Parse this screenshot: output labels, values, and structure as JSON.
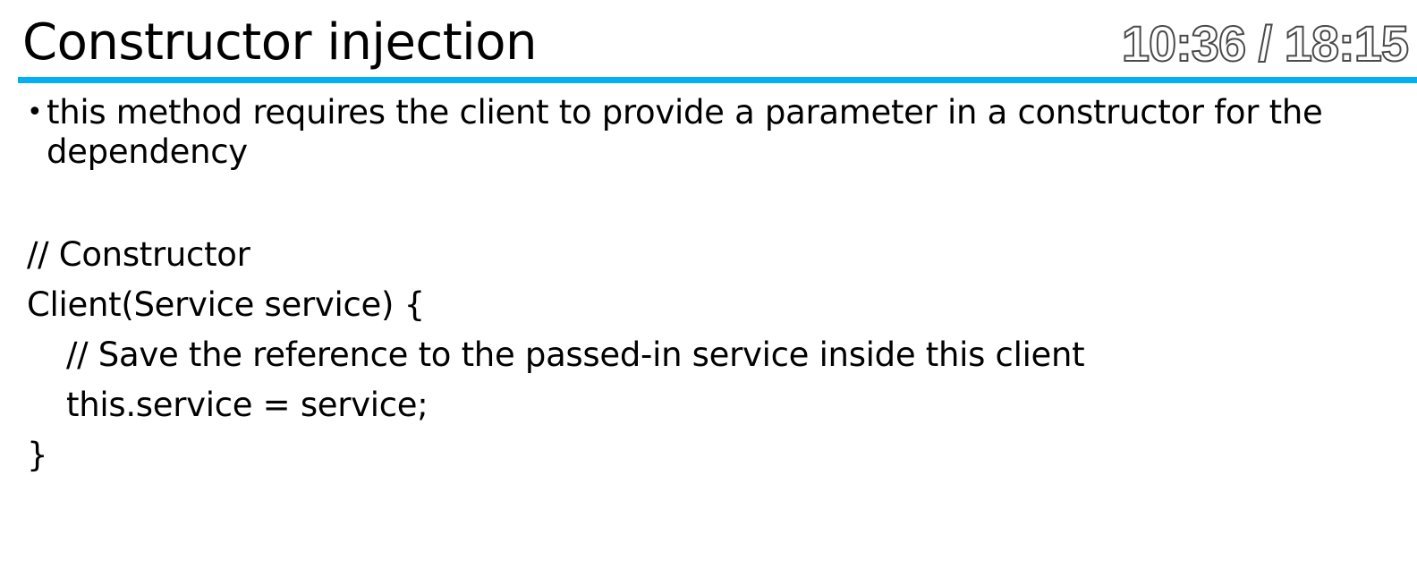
{
  "slide": {
    "title": "Constructor injection",
    "timer": "10:36 / 18:15",
    "accent_color": "#00b0f0",
    "bullet": {
      "mark": "•",
      "text": "this method requires the client to provide a parameter in a constructor for the dependency"
    },
    "code_lines": [
      "// Constructor",
      "Client(Service service) {",
      "// Save the reference to the passed-in service inside this client",
      "this.service = service;",
      "}"
    ]
  }
}
